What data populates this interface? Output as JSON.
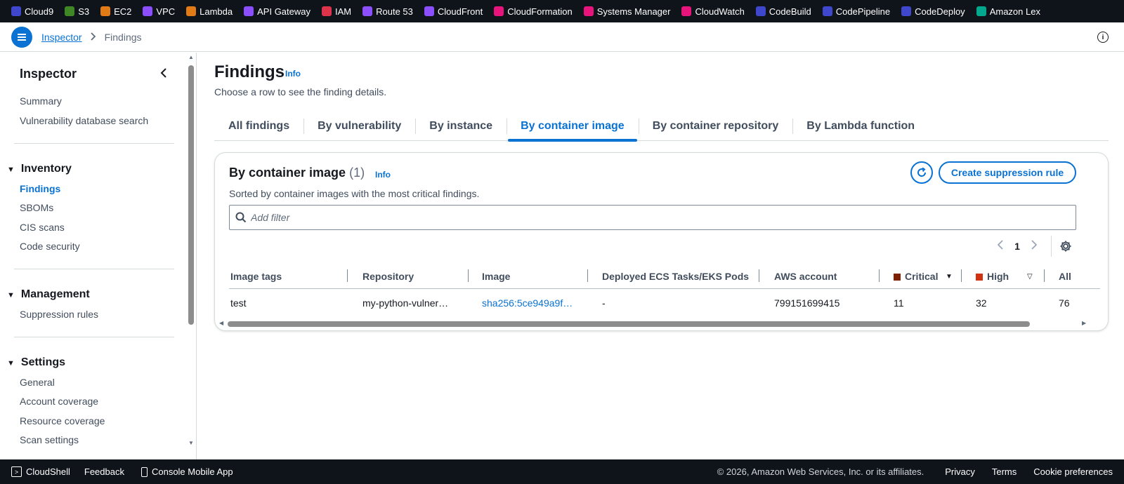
{
  "favorites": [
    {
      "label": "Cloud9",
      "color": "#3f48cc",
      "icon": "cloud9-icon"
    },
    {
      "label": "S3",
      "color": "#3f8624",
      "icon": "s3-icon"
    },
    {
      "label": "EC2",
      "color": "#e07b16",
      "icon": "ec2-icon"
    },
    {
      "label": "VPC",
      "color": "#8c4fff",
      "icon": "vpc-icon"
    },
    {
      "label": "Lambda",
      "color": "#e07b16",
      "icon": "lambda-icon"
    },
    {
      "label": "API Gateway",
      "color": "#8c4fff",
      "icon": "api-gateway-icon"
    },
    {
      "label": "IAM",
      "color": "#dd344c",
      "icon": "iam-icon"
    },
    {
      "label": "Route 53",
      "color": "#8c4fff",
      "icon": "route53-icon"
    },
    {
      "label": "CloudFront",
      "color": "#8c4fff",
      "icon": "cloudfront-icon"
    },
    {
      "label": "CloudFormation",
      "color": "#e7157b",
      "icon": "cloudformation-icon"
    },
    {
      "label": "Systems Manager",
      "color": "#e7157b",
      "icon": "systems-manager-icon"
    },
    {
      "label": "CloudWatch",
      "color": "#e7157b",
      "icon": "cloudwatch-icon"
    },
    {
      "label": "CodeBuild",
      "color": "#3f48cc",
      "icon": "codebuild-icon"
    },
    {
      "label": "CodePipeline",
      "color": "#3f48cc",
      "icon": "codepipeline-icon"
    },
    {
      "label": "CodeDeploy",
      "color": "#3f48cc",
      "icon": "codedeploy-icon"
    },
    {
      "label": "Amazon Lex",
      "color": "#01a88d",
      "icon": "lex-icon"
    }
  ],
  "breadcrumb": {
    "parent": "Inspector",
    "current": "Findings"
  },
  "sidenav": {
    "title": "Inspector",
    "top_links": [
      "Summary",
      "Vulnerability database search"
    ],
    "inventory": {
      "title": "Inventory",
      "links": [
        "Findings",
        "SBOMs",
        "CIS scans",
        "Code security"
      ]
    },
    "management": {
      "title": "Management",
      "links": [
        "Suppression rules"
      ]
    },
    "settings": {
      "title": "Settings",
      "links": [
        "General",
        "Account coverage",
        "Resource coverage",
        "Scan settings"
      ]
    }
  },
  "page": {
    "title": "Findings",
    "info": "Info",
    "description": "Choose a row to see the finding details."
  },
  "tabs": [
    "All findings",
    "By vulnerability",
    "By instance",
    "By container image",
    "By container repository",
    "By Lambda function"
  ],
  "active_tab": "By container image",
  "table_panel": {
    "title": "By container image",
    "count": "(1)",
    "info": "Info",
    "description": "Sorted by container images with the most critical findings.",
    "create_button": "Create suppression rule",
    "filter_placeholder": "Add filter",
    "page_number": "1",
    "columns": [
      "Image tags",
      "Repository",
      "Image",
      "Deployed ECS Tasks/EKS Pods",
      "AWS account",
      "Critical",
      "High",
      "All"
    ],
    "severity_colors": {
      "critical": "#7d2105",
      "high": "#d13212"
    },
    "rows": [
      {
        "image_tags": "test",
        "repository": "my-python-vulner…",
        "image": "sha256:5ce949a9f…",
        "deployed": "-",
        "account": "799151699415",
        "critical": "11",
        "high": "32",
        "all": "76"
      }
    ]
  },
  "footer": {
    "cloudshell": "CloudShell",
    "feedback": "Feedback",
    "mobile_app": "Console Mobile App",
    "copyright": "© 2026, Amazon Web Services, Inc. or its affiliates.",
    "privacy": "Privacy",
    "terms": "Terms",
    "cookies": "Cookie preferences"
  }
}
